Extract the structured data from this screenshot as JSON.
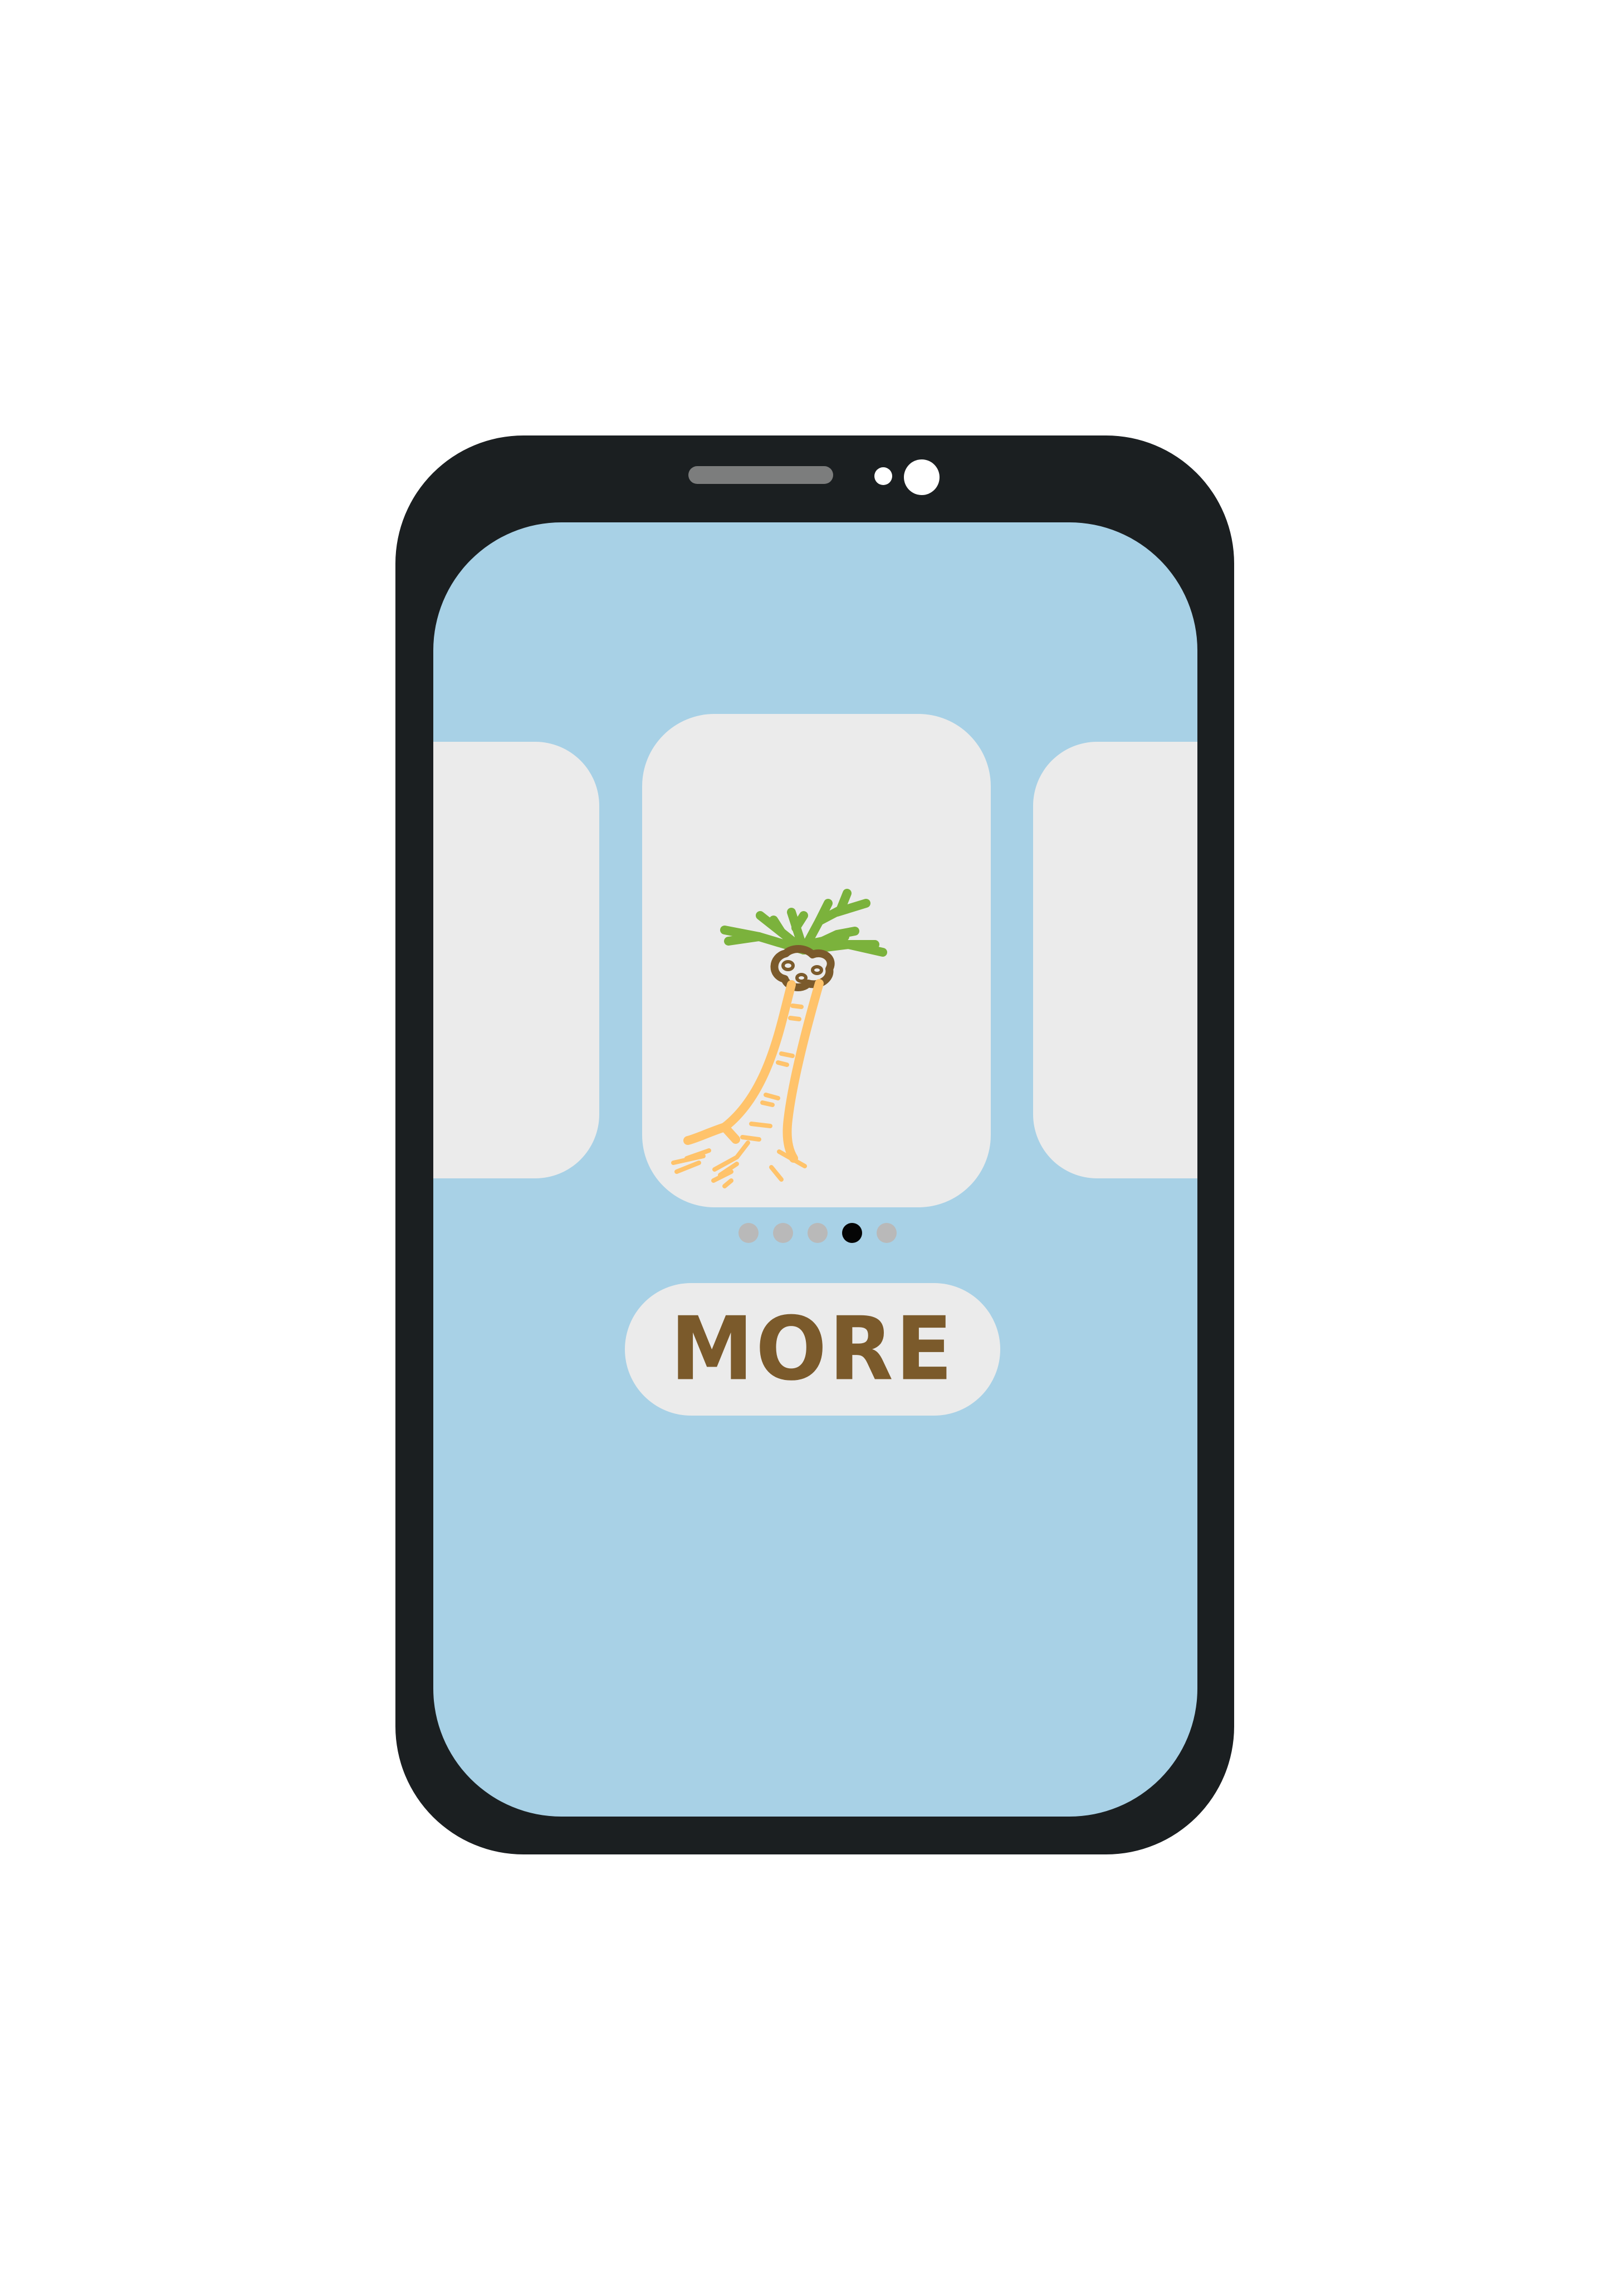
{
  "carousel": {
    "active_index": 3,
    "page_count": 5,
    "center_card_icon": "horseradish-root-icon"
  },
  "more_button": {
    "label": "MORE"
  },
  "colors": {
    "phone_body": "#1b1f21",
    "screen_background": "#a8d1e6",
    "card_background": "#ebebeb",
    "dot_inactive": "#b9b9b9",
    "dot_active": "#050505",
    "button_text": "#7b5a2b",
    "leaf_green": "#7bb23c",
    "root_orange": "#ffc36b"
  }
}
